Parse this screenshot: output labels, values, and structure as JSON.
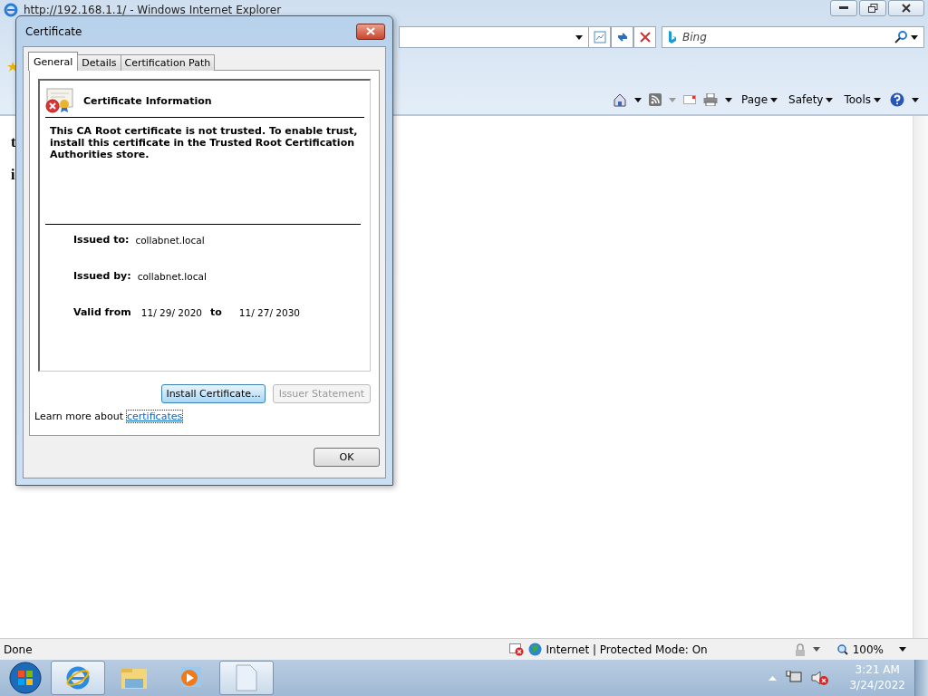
{
  "browser": {
    "title": "http://192.168.1.1/ - Windows Internet Explorer",
    "search_placeholder": "Bing",
    "command_bar": [
      "Page",
      "Safety",
      "Tools"
    ],
    "page_text": [
      "t",
      "i"
    ]
  },
  "dialog": {
    "title": "Certificate",
    "tabs": [
      {
        "label": "General",
        "selected": true
      },
      {
        "label": "Details",
        "selected": false
      },
      {
        "label": "Certification Path",
        "selected": false
      }
    ],
    "heading": "Certificate Information",
    "message": "This CA Root certificate is not trusted. To enable trust, install this certificate in the Trusted Root Certification Authorities store.",
    "fields": [
      {
        "label": "Issued to:",
        "value": "collabnet.local"
      },
      {
        "label": "Issued by:",
        "value": "collabnet.local"
      }
    ],
    "validity": {
      "label": "Valid from",
      "from": "11/ 29/ 2020",
      "joiner": "to",
      "to": "11/ 27/ 2030"
    },
    "buttons": [
      {
        "label": "Install Certificate...",
        "disabled": false
      },
      {
        "label": "Issuer Statement",
        "disabled": true
      }
    ],
    "learn_more": {
      "text": "Learn more about",
      "link": "certificates"
    },
    "ok": "OK"
  },
  "status_bar": {
    "text": "Done",
    "zone": "Internet | Protected Mode: On",
    "zoom": "100%"
  },
  "taskbar": {
    "time": "3:21 AM",
    "date": "3/24/2022"
  }
}
